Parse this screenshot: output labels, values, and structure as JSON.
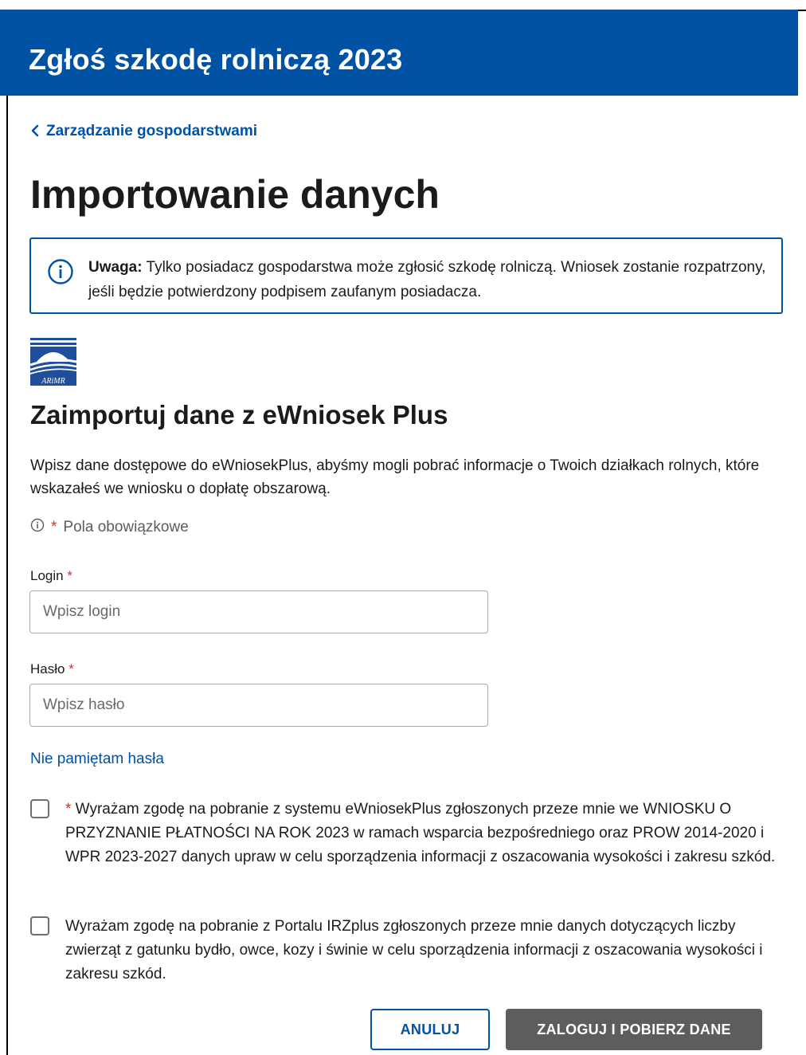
{
  "header": {
    "title": "Zgłoś szkodę rolniczą 2023"
  },
  "breadcrumb": {
    "back_label": "Zarządzanie gospodarstwami"
  },
  "page": {
    "title": "Importowanie danych"
  },
  "alert": {
    "strong": "Uwaga:",
    "text": " Tylko posiadacz gospodarstwa może zgłosić szkodę rolniczą. Wniosek zostanie rozpatrzony, jeśli będzie potwierdzony podpisem zaufanym posiadacza."
  },
  "logo": {
    "text": "ARiMR"
  },
  "section": {
    "title": "Zaimportuj dane z eWniosek Plus",
    "description": "Wpisz dane dostępowe do eWniosekPlus, abyśmy mogli pobrać informacje o Twoich działkach rolnych, które wskazałeś we wniosku o dopłatę obszarową.",
    "required_star": "*",
    "required_note": "Pola obowiązkowe"
  },
  "form": {
    "login": {
      "label": "Login",
      "star": "*",
      "placeholder": "Wpisz login",
      "value": ""
    },
    "password": {
      "label": "Hasło",
      "star": "*",
      "placeholder": "Wpisz hasło",
      "value": ""
    },
    "forgot_label": "Nie pamiętam hasła"
  },
  "consents": [
    {
      "star": "*",
      "text": " Wyrażam zgodę na pobranie z systemu eWniosekPlus zgłoszonych przeze mnie we WNIOSKU O PRZYZNANIE PŁATNOŚCI NA ROK 2023 w ramach wsparcia bezpośredniego oraz PROW 2014-2020 i WPR 2023-2027 danych upraw w celu sporządzenia informacji z oszacowania wysokości i zakresu szkód.",
      "checked": false
    },
    {
      "star": "",
      "text": "Wyrażam zgodę na pobranie z Portalu IRZplus zgłoszonych przeze mnie danych dotyczących liczby zwierząt z gatunku bydło, owce, kozy i świnie w celu sporządzenia informacji z oszacowania wysokości i zakresu szkód.",
      "checked": false
    }
  ],
  "actions": {
    "cancel_label": "ANULUJ",
    "submit_label": "ZALOGUJ I POBIERZ DANE"
  },
  "colors": {
    "brand": "#0052a5",
    "required": "#c0392b",
    "disabled_button": "#5d5d5d"
  },
  "icons": {
    "back": "chevron-left-icon",
    "info": "info-circle-icon",
    "logo": "arimr-logo"
  }
}
